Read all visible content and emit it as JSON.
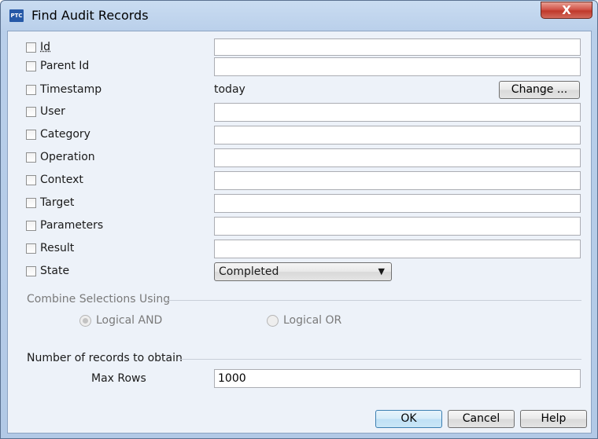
{
  "window": {
    "title": "Find Audit Records",
    "app_icon_text": "PTC",
    "close_glyph": "X"
  },
  "criteria": [
    {
      "label": "Id",
      "value": ""
    },
    {
      "label": "Parent Id",
      "value": ""
    },
    {
      "label": "Timestamp",
      "value": "today",
      "button": "Change ..."
    },
    {
      "label": "User",
      "value": ""
    },
    {
      "label": "Category",
      "value": ""
    },
    {
      "label": "Operation",
      "value": ""
    },
    {
      "label": "Context",
      "value": ""
    },
    {
      "label": "Target",
      "value": ""
    },
    {
      "label": "Parameters",
      "value": ""
    },
    {
      "label": "Result",
      "value": ""
    },
    {
      "label": "State",
      "selected": "Completed"
    }
  ],
  "combine": {
    "title": "Combine Selections Using",
    "options": [
      "Logical AND",
      "Logical OR"
    ],
    "selected": "Logical AND",
    "enabled": false
  },
  "records": {
    "title": "Number of records to obtain",
    "max_rows_label": "Max Rows",
    "max_rows_value": "1000"
  },
  "buttons": {
    "ok": "OK",
    "cancel": "Cancel",
    "help": "Help"
  },
  "colors": {
    "frame": "#b9cfea",
    "client": "#edf2f9",
    "close": "#c0392b",
    "primary_border": "#3c7fb1"
  },
  "icons": {
    "dropdown": "chevron-down-icon",
    "close": "close-icon"
  }
}
